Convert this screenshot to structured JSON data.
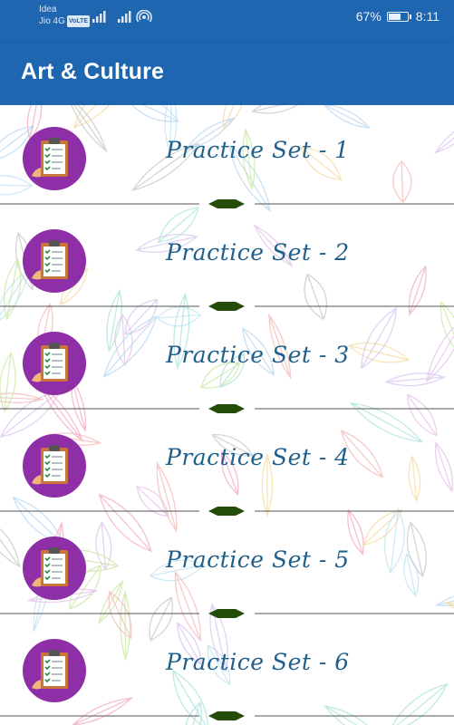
{
  "status_bar": {
    "carrier_1": "Idea",
    "carrier_2": "Jio 4G",
    "volte": "VoLTE",
    "battery": "67%",
    "battery_level": 0.67,
    "time": "8:11"
  },
  "app_bar": {
    "title": "Art & Culture"
  },
  "practice_sets": [
    {
      "label": "Practice Set - 1"
    },
    {
      "label": "Practice Set - 2"
    },
    {
      "label": "Practice Set - 3"
    },
    {
      "label": "Practice Set - 4"
    },
    {
      "label": "Practice Set - 5"
    },
    {
      "label": "Practice Set - 6"
    }
  ],
  "colors": {
    "app_bar": "#1e66b0",
    "label": "#1e5f8c",
    "avatar_bg": "#8e2fa8",
    "divider_diamond": "#254d07"
  },
  "icons": {
    "avatar": "clipboard-checklist-icon",
    "divider": "diamond-icon"
  }
}
